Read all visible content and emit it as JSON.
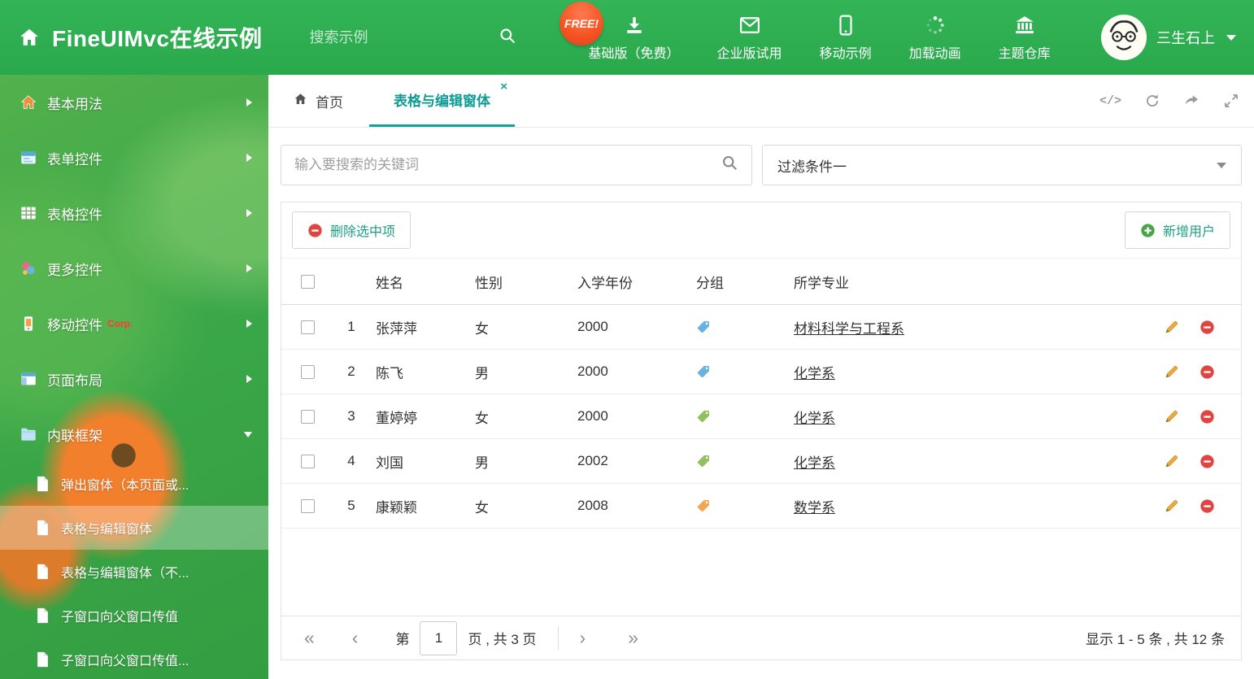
{
  "colors": {
    "header_green": "#2eb052",
    "tab_accent": "#12a39a",
    "button_text_teal": "#1d9e83",
    "delete_red": "#e04641",
    "add_green": "#47a447",
    "edit_pencil_orange": "#e8aa3d",
    "tag_blue": "#68b1e3",
    "tag_green": "#93c05f",
    "tag_orange": "#f2a654",
    "corp_red": "#ff3b30"
  },
  "header": {
    "title": "FineUIMvc在线示例",
    "search_placeholder": "搜索示例",
    "free_badge": "FREE!",
    "nav": [
      {
        "label": "基础版（免费）",
        "icon": "download-icon"
      },
      {
        "label": "企业版试用",
        "icon": "mail-icon"
      },
      {
        "label": "移动示例",
        "icon": "mobile-icon"
      },
      {
        "label": "加载动画",
        "icon": "loading-dots-icon"
      },
      {
        "label": "主题仓库",
        "icon": "bank-icon"
      }
    ],
    "username": "三生石上"
  },
  "sidebar": {
    "items": [
      {
        "label": "基本用法"
      },
      {
        "label": "表单控件"
      },
      {
        "label": "表格控件"
      },
      {
        "label": "更多控件"
      },
      {
        "label": "移动控件",
        "badge": "Corp."
      },
      {
        "label": "页面布局"
      },
      {
        "label": "内联框架"
      }
    ],
    "children": [
      {
        "label": "弹出窗体（本页面或..."
      },
      {
        "label": "表格与编辑窗体"
      },
      {
        "label": "表格与编辑窗体（不..."
      },
      {
        "label": "子窗口向父窗口传值"
      },
      {
        "label": "子窗口向父窗口传值..."
      }
    ]
  },
  "tabs": {
    "home": "首页",
    "active": "表格与编辑窗体",
    "close_glyph": "×"
  },
  "tools": {
    "code_glyph": "</>"
  },
  "filter": {
    "search_placeholder": "输入要搜索的关键词",
    "dropdown_value": "过滤条件一"
  },
  "toolbar": {
    "delete": "删除选中项",
    "add": "新增用户"
  },
  "table": {
    "headers": {
      "name": "姓名",
      "gender": "性别",
      "year": "入学年份",
      "group": "分组",
      "major": "所学专业"
    },
    "rows": [
      {
        "no": "1",
        "name": "张萍萍",
        "gender": "女",
        "year": "2000",
        "tag_color": "#68b1e3",
        "major": "材料科学与工程系"
      },
      {
        "no": "2",
        "name": "陈飞",
        "gender": "男",
        "year": "2000",
        "tag_color": "#68b1e3",
        "major": "化学系"
      },
      {
        "no": "3",
        "name": "董婷婷",
        "gender": "女",
        "year": "2000",
        "tag_color": "#93c05f",
        "major": "化学系"
      },
      {
        "no": "4",
        "name": "刘国",
        "gender": "男",
        "year": "2002",
        "tag_color": "#93c05f",
        "major": "化学系"
      },
      {
        "no": "5",
        "name": "康颖颖",
        "gender": "女",
        "year": "2008",
        "tag_color": "#f2a654",
        "major": "数学系"
      }
    ]
  },
  "pager": {
    "first_glyph": "«",
    "prev_glyph": "‹",
    "next_glyph": "›",
    "last_glyph": "»",
    "prefix": "第",
    "page_value": "1",
    "suffix": "页 , 共 3 页",
    "summary": "显示 1 - 5 条 , 共 12 条"
  }
}
